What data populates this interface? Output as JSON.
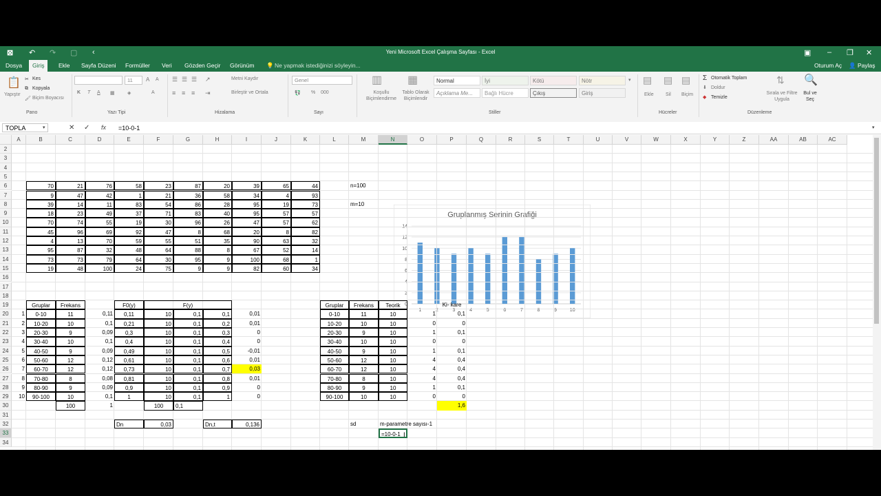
{
  "window": {
    "title": "Yeni Microsoft Excel Çalışma Sayfası - Excel",
    "login": "Oturum Aç",
    "share": "Paylaş"
  },
  "tabs": [
    "Dosya",
    "Giriş",
    "Ekle",
    "Sayfa Düzeni",
    "Formüller",
    "Veri",
    "Gözden Geçir",
    "Görünüm"
  ],
  "tell_me": "Ne yapmak istediğinizi söyleyin...",
  "ribbon": {
    "clipboard": {
      "paste": "Yapıştır",
      "cut": "Kes",
      "copy": "Kopyala",
      "painter": "Biçim Boyacısı",
      "group": "Pano"
    },
    "font": {
      "size": "11",
      "group": "Yazı Tipi",
      "bold": "K",
      "italic": "T",
      "underline": "A"
    },
    "align": {
      "wrap": "Metni Kaydır",
      "merge": "Birleştir ve Ortala",
      "group": "Hizalama"
    },
    "number": {
      "format": "Genel",
      "group": "Sayı"
    },
    "styles": {
      "cond": "Koşullu Biçimlendirme",
      "table": "Tablo Olarak Biçimlendir",
      "normal": "Normal",
      "iyi": "İyi",
      "kotu": "Kötü",
      "notr": "Nötr",
      "aciklama": "Açıklama Me...",
      "bagli": "Bağlı Hücre",
      "cikis": "Çıkış",
      "giris": "Giriş",
      "group": "Stiller"
    },
    "cells": {
      "insert": "Ekle",
      "delete": "Sil",
      "format": "Biçim",
      "group": "Hücreler"
    },
    "editing": {
      "autosum": "Otomatik Toplam",
      "fill": "Doldur",
      "clear": "Temizle",
      "sort": "Sırala ve Filtre Uygula",
      "find": "Bul ve Seç",
      "group": "Düzenleme"
    }
  },
  "formula_bar": {
    "name_box": "TOPLA",
    "formula": "=10-0-1",
    "fx": "fx"
  },
  "columns": [
    "A",
    "B",
    "C",
    "D",
    "E",
    "F",
    "G",
    "H",
    "I",
    "J",
    "K",
    "L",
    "M",
    "N",
    "O",
    "P",
    "Q",
    "R",
    "S",
    "T",
    "U",
    "V",
    "W",
    "X",
    "Y",
    "Z",
    "AA",
    "AB",
    "AC"
  ],
  "rows": [
    "2",
    "3",
    "4",
    "5",
    "6",
    "7",
    "8",
    "9",
    "10",
    "11",
    "12",
    "13",
    "14",
    "15",
    "16",
    "17",
    "18",
    "19",
    "20",
    "21",
    "22",
    "23",
    "24",
    "25",
    "26",
    "27",
    "28",
    "29",
    "30",
    "31",
    "32",
    "33",
    "34"
  ],
  "raw_table": [
    [
      "70",
      "21",
      "76",
      "58",
      "23",
      "87",
      "20",
      "39",
      "65",
      "44"
    ],
    [
      "9",
      "47",
      "42",
      "1",
      "21",
      "36",
      "58",
      "34",
      "4",
      "93"
    ],
    [
      "39",
      "14",
      "11",
      "83",
      "54",
      "86",
      "28",
      "95",
      "19",
      "73"
    ],
    [
      "18",
      "23",
      "49",
      "37",
      "71",
      "83",
      "40",
      "95",
      "57",
      "57"
    ],
    [
      "70",
      "74",
      "55",
      "19",
      "30",
      "96",
      "26",
      "47",
      "57",
      "62"
    ],
    [
      "45",
      "96",
      "69",
      "92",
      "47",
      "8",
      "68",
      "20",
      "8",
      "82"
    ],
    [
      "4",
      "13",
      "70",
      "59",
      "55",
      "51",
      "35",
      "90",
      "63",
      "32"
    ],
    [
      "95",
      "87",
      "32",
      "48",
      "64",
      "88",
      "8",
      "67",
      "52",
      "14"
    ],
    [
      "73",
      "73",
      "79",
      "64",
      "30",
      "95",
      "9",
      "100",
      "68",
      "1"
    ],
    [
      "19",
      "48",
      "100",
      "24",
      "75",
      "9",
      "9",
      "82",
      "60",
      "34"
    ]
  ],
  "params": {
    "n": "n=100",
    "m": "m=10"
  },
  "freq_table": {
    "headers": {
      "gruplar": "Gruplar",
      "frekans": "Frekans",
      "f0": "F0(y)",
      "fy": "F(y)"
    },
    "rows": [
      [
        "1",
        "0-10",
        "11",
        "0,11",
        "0,11",
        "10",
        "0,1",
        "0,1",
        "0,01"
      ],
      [
        "2",
        "10-20",
        "10",
        "0,1",
        "0,21",
        "10",
        "0,1",
        "0,2",
        "0,01"
      ],
      [
        "3",
        "20-30",
        "9",
        "0,09",
        "0,3",
        "10",
        "0,1",
        "0,3",
        "0"
      ],
      [
        "4",
        "30-40",
        "10",
        "0,1",
        "0,4",
        "10",
        "0,1",
        "0,4",
        "0"
      ],
      [
        "5",
        "40-50",
        "9",
        "0,09",
        "0,49",
        "10",
        "0,1",
        "0,5",
        "-0,01"
      ],
      [
        "6",
        "50-60",
        "12",
        "0,12",
        "0,61",
        "10",
        "0,1",
        "0,6",
        "0,01"
      ],
      [
        "7",
        "60-70",
        "12",
        "0,12",
        "0,73",
        "10",
        "0,1",
        "0,7",
        "0,03"
      ],
      [
        "8",
        "70-80",
        "8",
        "0,08",
        "0,81",
        "10",
        "0,1",
        "0,8",
        "0,01"
      ],
      [
        "9",
        "80-90",
        "9",
        "0,09",
        "0,9",
        "10",
        "0,1",
        "0,9",
        "0"
      ],
      [
        "10",
        "90-100",
        "10",
        "0,1",
        "1",
        "10",
        "0,1",
        "1",
        "0"
      ]
    ],
    "totals": {
      "frekans": "100",
      "d": "1",
      "f": "100",
      "g": "0,1"
    },
    "dn_label": "Dn",
    "dn_value": "0,03",
    "dnt_label": "Dn,t",
    "dnt_value": "0,136"
  },
  "chi_table": {
    "headers": {
      "gruplar": "Gruplar",
      "frekans": "Frekans",
      "teorik": "Teorik",
      "chi": "Ki- kare"
    },
    "rows": [
      [
        "0-10",
        "11",
        "10",
        "1",
        "0,1"
      ],
      [
        "10-20",
        "10",
        "10",
        "0",
        "0"
      ],
      [
        "20-30",
        "9",
        "10",
        "1",
        "0,1"
      ],
      [
        "30-40",
        "10",
        "10",
        "0",
        "0"
      ],
      [
        "40-50",
        "9",
        "10",
        "1",
        "0,1"
      ],
      [
        "50-60",
        "12",
        "10",
        "4",
        "0,4"
      ],
      [
        "60-70",
        "12",
        "10",
        "4",
        "0,4"
      ],
      [
        "70-80",
        "8",
        "10",
        "4",
        "0,4"
      ],
      [
        "80-90",
        "9",
        "10",
        "1",
        "0,1"
      ],
      [
        "90-100",
        "10",
        "10",
        "0",
        "0"
      ]
    ],
    "total": "1,6",
    "sd_label": "sd",
    "sd_note": "m-parametre sayısı-1",
    "edit_cell": "=10-0-1"
  },
  "colors": {
    "excel_green": "#217346",
    "highlight": "#ffff00",
    "bar": "#5b9bd5"
  },
  "chart_data": {
    "type": "bar",
    "title": "Gruplanmış Serinin Grafiği",
    "categories": [
      "1",
      "2",
      "3",
      "4",
      "5",
      "6",
      "7",
      "8",
      "9",
      "10"
    ],
    "values": [
      11,
      10,
      9,
      10,
      9,
      12,
      12,
      8,
      9,
      10
    ],
    "ylim": [
      0,
      14
    ],
    "yticks": [
      "0",
      "2",
      "4",
      "6",
      "8",
      "10",
      "12",
      "14"
    ],
    "grid": true
  }
}
